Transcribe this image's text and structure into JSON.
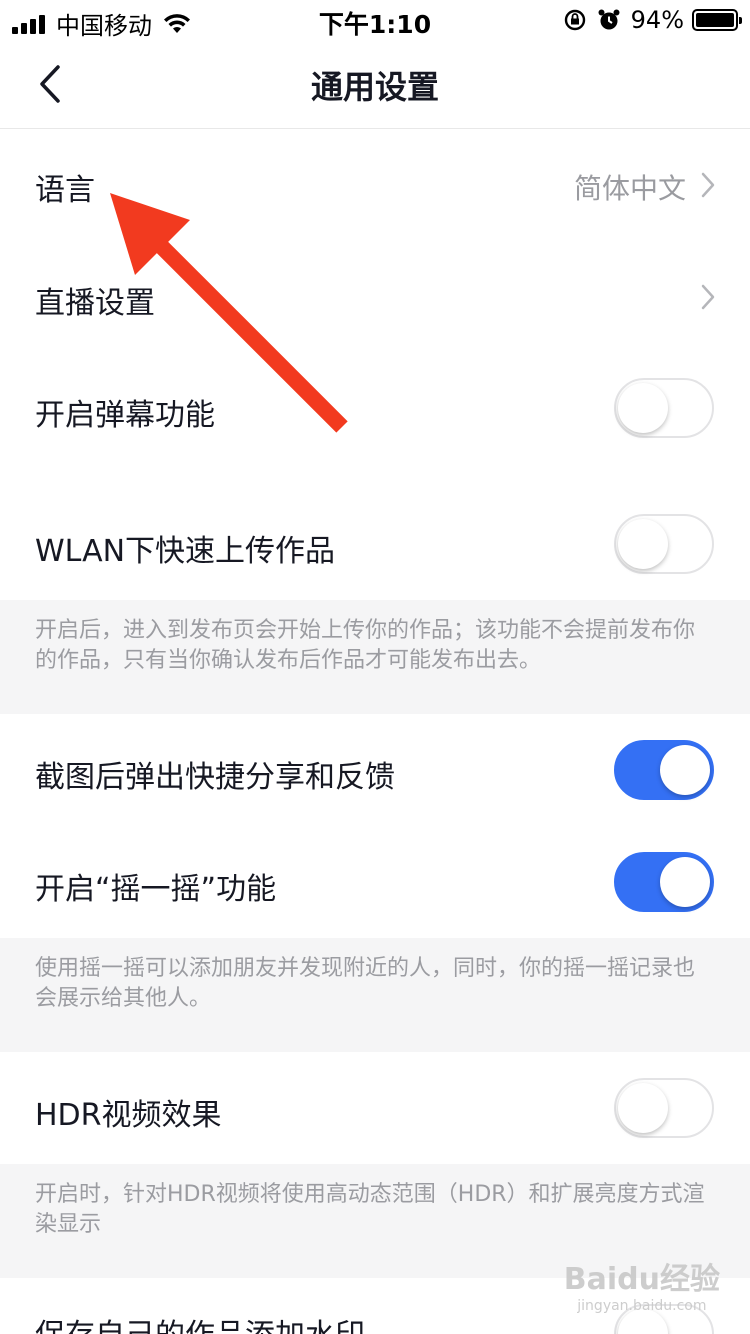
{
  "status_bar": {
    "carrier": "中国移动",
    "time": "下午1:10",
    "battery": "94%"
  },
  "nav": {
    "title": "通用设置",
    "back_icon": "chevron-left-icon"
  },
  "settings": {
    "language": {
      "label": "语言",
      "value": "简体中文"
    },
    "live": {
      "label": "直播设置"
    },
    "danmaku": {
      "label": "开启弹幕功能",
      "enabled": false
    },
    "wlan_upload": {
      "label": "WLAN下快速上传作品",
      "enabled": false
    },
    "wlan_note": "开启后，进入到发布页会开始上传你的作品；该功能不会提前发布你的作品，只有当你确认发布后作品才可能发布出去。",
    "screenshot_share": {
      "label": "截图后弹出快捷分享和反馈",
      "enabled": true
    },
    "shake": {
      "label": "开启“摇一摇”功能",
      "enabled": true
    },
    "shake_note": "使用摇一摇可以添加朋友并发现附近的人，同时，你的摇一摇记录也会展示给其他人。",
    "hdr": {
      "label": "HDR视频效果",
      "enabled": false
    },
    "hdr_note": "开启时，针对HDR视频将使用高动态范围（HDR）和扩展亮度方式渲染显示",
    "watermark": {
      "label": "保存自己的作品添加水印"
    }
  },
  "colors": {
    "accent": "#3470f4",
    "annotation": "#f23a1f"
  },
  "watermark_text": {
    "brand": "Baidu经验",
    "url": "jingyan.baidu.com"
  }
}
